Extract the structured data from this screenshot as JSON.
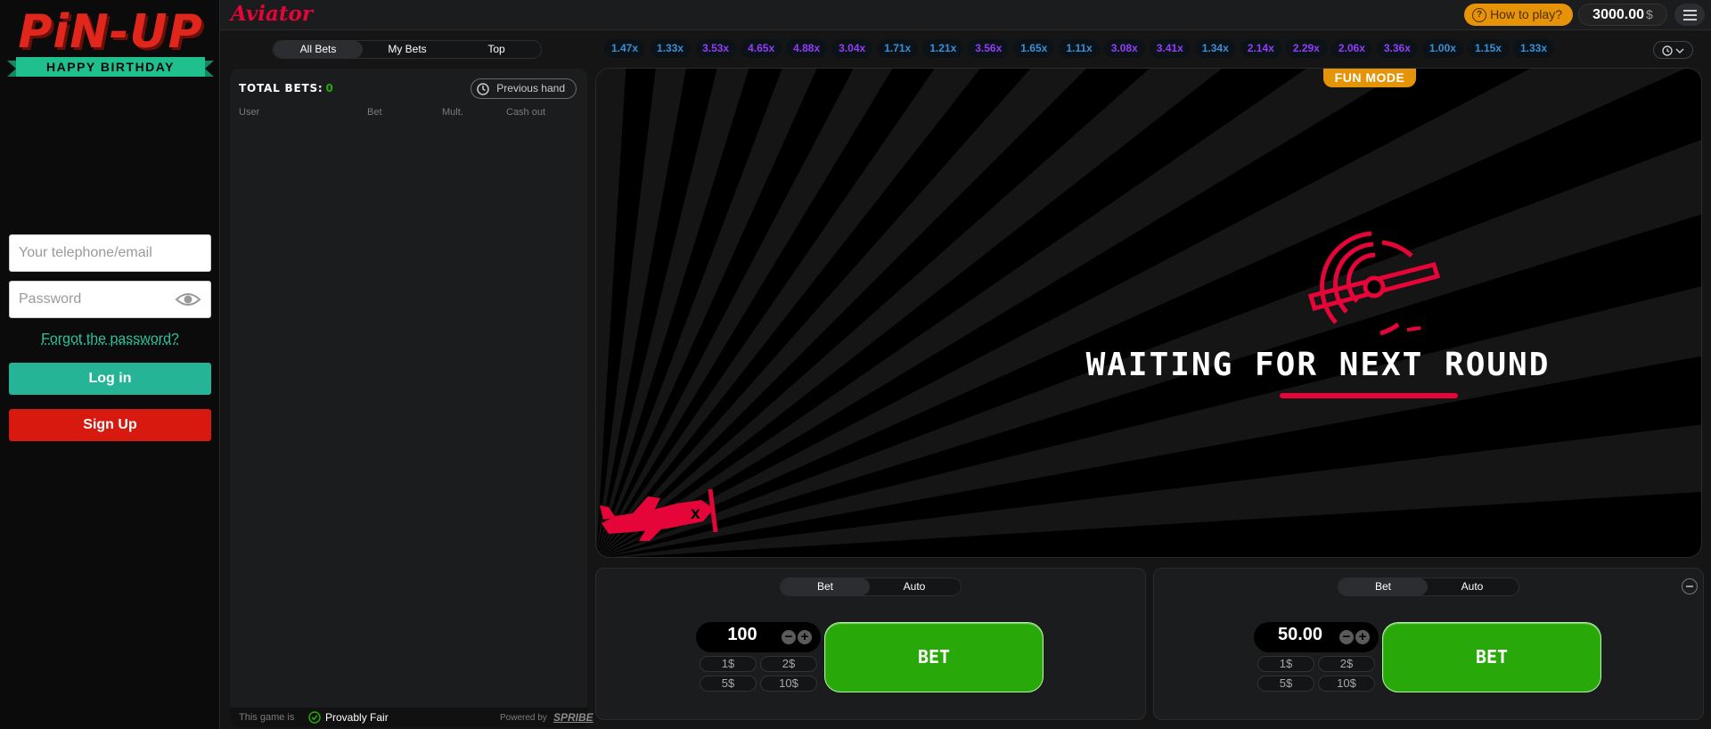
{
  "site": {
    "logo_text": "PiN-UP",
    "logo_subtitle": "HAPPY BIRTHDAY",
    "login": {
      "telephone_placeholder": "Your telephone/email",
      "password_placeholder": "Password",
      "forgot_label": "Forgot the password?",
      "login_label": "Log in",
      "signup_label": "Sign Up"
    },
    "colors": {
      "login": "#26b497",
      "signup": "#d7190f",
      "brand_red": "#e1261c"
    }
  },
  "game": {
    "title": "Aviator",
    "how_to_play": "How to play?",
    "balance": "3000.00",
    "currency": "$",
    "icons": {
      "how_to": "question-icon",
      "menu": "hamburger-icon",
      "history": "history-icon"
    }
  },
  "bets_panel": {
    "tabs": [
      "All Bets",
      "My Bets",
      "Top"
    ],
    "active_tab": "All Bets",
    "total_bets_label": "TOTAL BETS:",
    "total_bets_count": "0",
    "previous_hand": "Previous hand",
    "columns": [
      "User",
      "Bet",
      "Mult.",
      "Cash out"
    ],
    "footer": {
      "this_game_is": "This game is",
      "provably_fair": "Provably Fair",
      "powered_by": "Powered by",
      "provider": "SPRIBE"
    }
  },
  "history": [
    {
      "value": "1.47x",
      "color": "#3d8fd1"
    },
    {
      "value": "1.33x",
      "color": "#3d8fd1"
    },
    {
      "value": "3.53x",
      "color": "#913ef8"
    },
    {
      "value": "4.65x",
      "color": "#913ef8"
    },
    {
      "value": "4.88x",
      "color": "#913ef8"
    },
    {
      "value": "3.04x",
      "color": "#913ef8"
    },
    {
      "value": "1.71x",
      "color": "#3d8fd1"
    },
    {
      "value": "1.21x",
      "color": "#3d8fd1"
    },
    {
      "value": "3.56x",
      "color": "#913ef8"
    },
    {
      "value": "1.65x",
      "color": "#3d8fd1"
    },
    {
      "value": "1.11x",
      "color": "#3d8fd1"
    },
    {
      "value": "3.08x",
      "color": "#913ef8"
    },
    {
      "value": "3.41x",
      "color": "#913ef8"
    },
    {
      "value": "1.34x",
      "color": "#3d8fd1"
    },
    {
      "value": "2.14x",
      "color": "#913ef8"
    },
    {
      "value": "2.29x",
      "color": "#913ef8"
    },
    {
      "value": "2.06x",
      "color": "#913ef8"
    },
    {
      "value": "3.36x",
      "color": "#913ef8"
    },
    {
      "value": "1.00x",
      "color": "#3d8fd1"
    },
    {
      "value": "1.15x",
      "color": "#3d8fd1"
    },
    {
      "value": "1.33x",
      "color": "#3d8fd1"
    }
  ],
  "stage": {
    "fun_mode": "FUN MODE",
    "status": "WAITING FOR NEXT ROUND",
    "accent": "#e50539"
  },
  "bet_panels": [
    {
      "tabs": [
        "Bet",
        "Auto"
      ],
      "active_tab": "Bet",
      "amount": "100",
      "quick": [
        "1$",
        "2$",
        "5$",
        "10$"
      ],
      "button": "BET"
    },
    {
      "tabs": [
        "Bet",
        "Auto"
      ],
      "active_tab": "Bet",
      "amount": "50.00",
      "quick": [
        "1$",
        "2$",
        "5$",
        "10$"
      ],
      "button": "BET"
    }
  ]
}
